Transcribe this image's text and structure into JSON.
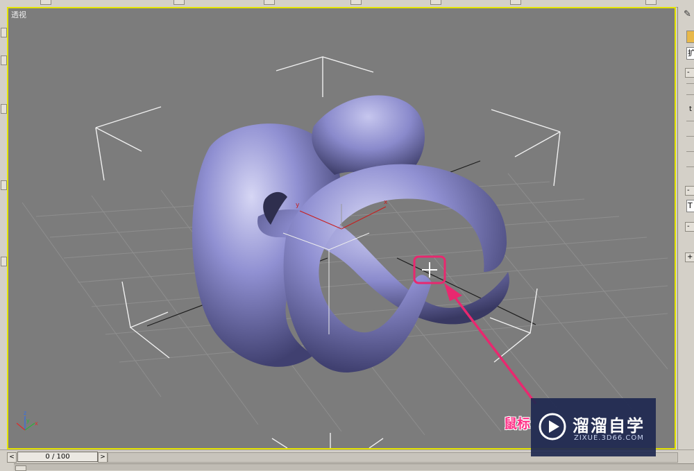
{
  "viewport": {
    "label": "透视",
    "active": true,
    "background_color": "#7c7c7c",
    "border_color": "#e4e400",
    "object_color": "#8c8cd0",
    "cursor": "move-crosshair",
    "annotation": "highlight-box-with-arrow",
    "annotation_color": "#e8286f",
    "axis_gizmo": {
      "x": "x",
      "y": "y",
      "z": "z"
    }
  },
  "right_panel": {
    "field_top": "扩",
    "rollout_1": "-",
    "rollout_2": "-",
    "rollout_3": "-",
    "rollout_4": "+",
    "mid_label": "t",
    "field_mid": "T"
  },
  "time_slider": {
    "value": "0 / 100",
    "prev_label": "<",
    "next_label": ">"
  },
  "watermark": {
    "title": "溜溜自学",
    "subtitle": "ZIXUE.3D66.COM",
    "caption_partial": "鼠标"
  }
}
